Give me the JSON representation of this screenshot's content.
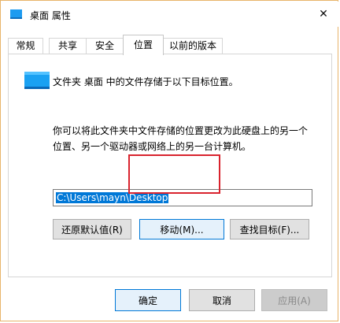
{
  "window": {
    "title": "桌面 属性",
    "close_glyph": "✕"
  },
  "tabs": [
    {
      "label": "常规"
    },
    {
      "label": "共享"
    },
    {
      "label": "安全"
    },
    {
      "label": "位置"
    },
    {
      "label": "以前的版本"
    }
  ],
  "location": {
    "current_text": "文件夹 桌面 中的文件存储于以下目标位置。",
    "description_line1": "你可以将此文件夹中文件存储的位置更改为此硬盘上的另一个",
    "description_line2": "位置、另一个驱动器或网络上的另一台计算机。",
    "path_value": "C:\\Users\\mayn\\Desktop",
    "restore_label": "还原默认值(R)",
    "move_label": "移动(M)...",
    "find_target_label": "查找目标(F)..."
  },
  "footer": {
    "ok_label": "确定",
    "cancel_label": "取消",
    "apply_label": "应用(A)"
  },
  "colors": {
    "accent": "#0078d7",
    "highlight": "#d9232e",
    "frame": "#e8b46a"
  }
}
